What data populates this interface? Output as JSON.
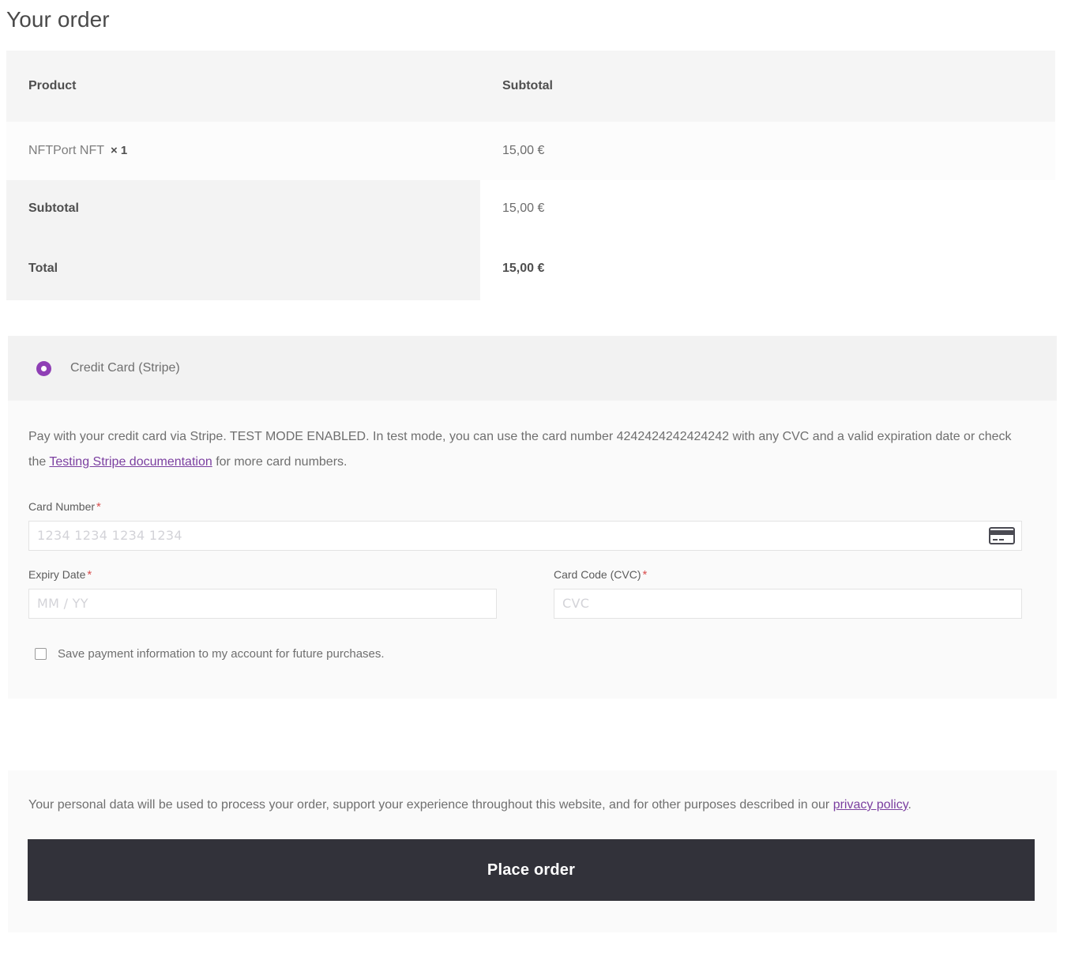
{
  "page": {
    "title": "Your order"
  },
  "order_table": {
    "headers": {
      "product": "Product",
      "subtotal": "Subtotal"
    },
    "items": [
      {
        "name": "NFTPort NFT",
        "quantity": "× 1",
        "subtotal": "15,00 €"
      }
    ],
    "totals": [
      {
        "label": "Subtotal",
        "value": "15,00 €"
      },
      {
        "label": "Total",
        "value": "15,00 €"
      }
    ]
  },
  "payment": {
    "method_label": "Credit Card (Stripe)",
    "method_selected": true,
    "description_part1": "Pay with your credit card via Stripe. TEST MODE ENABLED. In test mode, you can use the card number 4242424242424242 with any CVC and a valid expiration date or check the ",
    "description_link": "Testing Stripe documentation",
    "description_part2": " for more card numbers.",
    "test_card_number": "4242424242424242",
    "fields": {
      "card_number": {
        "label": "Card Number",
        "required_marker": "*",
        "placeholder": "1234 1234 1234 1234",
        "value": "",
        "icon": "credit-card-icon"
      },
      "expiry": {
        "label": "Expiry Date",
        "required_marker": "*",
        "placeholder": "MM / YY",
        "value": ""
      },
      "cvc": {
        "label": "Card Code (CVC)",
        "required_marker": "*",
        "placeholder": "CVC",
        "value": ""
      }
    },
    "save_card": {
      "label": "Save payment information to my account for future purchases.",
      "checked": false
    }
  },
  "footer": {
    "privacy_part1": "Your personal data will be used to process your order, support your experience throughout this website, and for other purposes described in our ",
    "privacy_link": "privacy policy",
    "privacy_part2": ".",
    "place_order_label": "Place order"
  },
  "colors": {
    "accent_purple": "#8f3fb5",
    "link_purple": "#7b3fa0",
    "button_dark": "#32323a",
    "required_red": "#d94f4f",
    "panel_gray": "#fafafa",
    "header_gray": "#f2f2f2"
  }
}
